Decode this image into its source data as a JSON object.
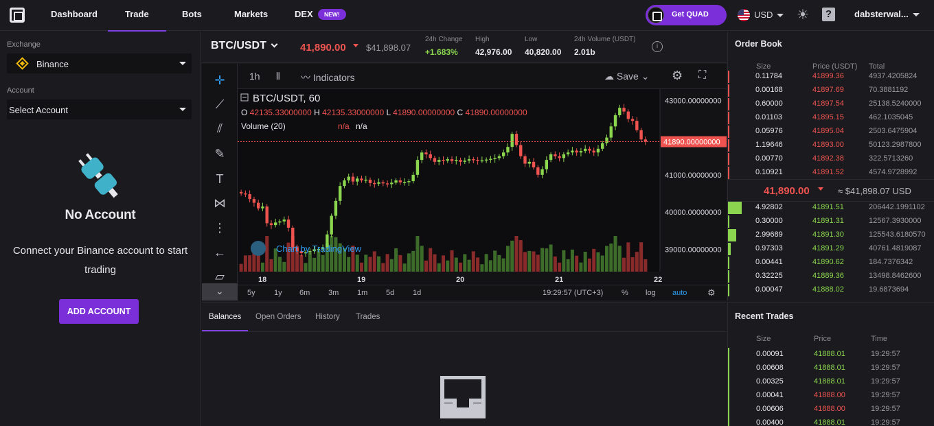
{
  "nav": {
    "items": [
      "Dashboard",
      "Trade",
      "Bots",
      "Markets",
      "DEX"
    ],
    "active": "Trade",
    "new_badge": "NEW!",
    "get_quad": "Get QUAD",
    "currency": "USD",
    "user": "dabsterwal..."
  },
  "left": {
    "exchange_label": "Exchange",
    "exchange_value": "Binance",
    "account_label": "Account",
    "account_value": "Select Account",
    "no_account_title": "No Account",
    "connect_text": "Connect your Binance account to start trading",
    "add_account": "ADD ACCOUNT"
  },
  "ticker": {
    "pair": "BTC/USDT",
    "price": "41,890.00",
    "price_usd": "$41,898.07",
    "stats": [
      {
        "label": "24h Change",
        "value": "+1.683%",
        "color": "#8bd64e"
      },
      {
        "label": "High",
        "value": "42,976.00",
        "color": "#e8e8ec"
      },
      {
        "label": "Low",
        "value": "40,820.00",
        "color": "#e8e8ec"
      },
      {
        "label": "24h Volume (USDT)",
        "value": "2.01b",
        "color": "#e8e8ec"
      }
    ]
  },
  "chart": {
    "interval": "1h",
    "indicators": "Indicators",
    "save": "Save",
    "legend_title": "BTC/USDT, 60",
    "ohlc": {
      "O": "42135.33000000",
      "H": "42135.33000000",
      "L": "41890.00000000",
      "C": "41890.00000000"
    },
    "volume_label": "Volume (20)",
    "volume_vals": [
      "n/a",
      "n/a"
    ],
    "watermark": "Chart by TradingView",
    "last_price_label": "41890.00000000",
    "ranges": [
      "5y",
      "1y",
      "6m",
      "3m",
      "1m",
      "5d",
      "1d"
    ],
    "clock": "19:29:57 (UTC+3)",
    "pct": "%",
    "log": "log",
    "auto": "auto"
  },
  "chart_data": {
    "type": "candlestick",
    "title": "BTC/USDT, 60",
    "y_ticks": [
      "43000.00000000",
      "41000.00000000",
      "40000.00000000",
      "39000.00000000"
    ],
    "x_ticks": [
      "18",
      "19",
      "20",
      "21",
      "22"
    ],
    "ylim": [
      38400,
      43300
    ],
    "up_color": "#8bd64e",
    "down_color": "#ef5350",
    "close_series": [
      40500,
      40480,
      40350,
      40250,
      40100,
      40150,
      39700,
      39650,
      39720,
      39750,
      39800,
      39580,
      39050,
      38950,
      38900,
      38920,
      38950,
      39000,
      39010,
      39050,
      39400,
      39900,
      40300,
      40700,
      40850,
      40950,
      40820,
      40900,
      40850,
      40870,
      40780,
      40760,
      40800,
      40770,
      40750,
      40790,
      40850,
      40800,
      40810,
      40830,
      41000,
      41400,
      41600,
      41550,
      41450,
      41350,
      41400,
      41380,
      41420,
      41370,
      41400,
      41350,
      41380,
      41420,
      41400,
      41380,
      41390,
      41410,
      41430,
      41450,
      41500,
      41600,
      41750,
      42100,
      41800,
      41500,
      41300,
      41350,
      41200,
      41000,
      41150,
      41400,
      41550,
      41500,
      41450,
      41550,
      41600,
      41650,
      41600,
      41640,
      41700,
      41650,
      41600,
      41700,
      41850,
      42000,
      42300,
      42600,
      42800,
      42700,
      42500,
      42450,
      42200,
      41950,
      41890
    ]
  },
  "orders_tabs": [
    "Balances",
    "Open Orders",
    "History",
    "Trades"
  ],
  "order_book": {
    "title": "Order Book",
    "headers": [
      "Size",
      "Price (USDT)",
      "Total"
    ],
    "asks": [
      {
        "size": "0.11784",
        "price": "41899.36",
        "total": "4937.4205824"
      },
      {
        "size": "0.00168",
        "price": "41897.69",
        "total": "70.3881192"
      },
      {
        "size": "0.60000",
        "price": "41897.54",
        "total": "25138.5240000"
      },
      {
        "size": "0.01103",
        "price": "41895.15",
        "total": "462.1035045"
      },
      {
        "size": "0.05976",
        "price": "41895.04",
        "total": "2503.6475904"
      },
      {
        "size": "1.19646",
        "price": "41893.00",
        "total": "50123.2987800"
      },
      {
        "size": "0.00770",
        "price": "41892.38",
        "total": "322.5713260"
      },
      {
        "size": "0.10921",
        "price": "41891.52",
        "total": "4574.9728992"
      }
    ],
    "mid_price": "41,890.00",
    "mid_usd": "≈ $41,898.07 USD",
    "bids": [
      {
        "size": "4.92802",
        "price": "41891.51",
        "total": "206442.1991102"
      },
      {
        "size": "0.30000",
        "price": "41891.31",
        "total": "12567.3930000"
      },
      {
        "size": "2.99689",
        "price": "41891.30",
        "total": "125543.6180570"
      },
      {
        "size": "0.97303",
        "price": "41891.29",
        "total": "40761.4819087"
      },
      {
        "size": "0.00441",
        "price": "41890.62",
        "total": "184.7376342"
      },
      {
        "size": "0.32225",
        "price": "41889.36",
        "total": "13498.8462600"
      },
      {
        "size": "0.00047",
        "price": "41888.02",
        "total": "19.6873694"
      }
    ]
  },
  "recent_trades": {
    "title": "Recent Trades",
    "headers": [
      "Size",
      "Price",
      "Time"
    ],
    "rows": [
      {
        "size": "0.00091",
        "price": "41888.01",
        "time": "19:29:57",
        "side": "buy"
      },
      {
        "size": "0.00608",
        "price": "41888.01",
        "time": "19:29:57",
        "side": "buy"
      },
      {
        "size": "0.00325",
        "price": "41888.01",
        "time": "19:29:57",
        "side": "buy"
      },
      {
        "size": "0.00041",
        "price": "41888.00",
        "time": "19:29:57",
        "side": "sell"
      },
      {
        "size": "0.00606",
        "price": "41888.00",
        "time": "19:29:57",
        "side": "sell"
      },
      {
        "size": "0.00400",
        "price": "41888.01",
        "time": "19:29:57",
        "side": "buy"
      }
    ]
  }
}
